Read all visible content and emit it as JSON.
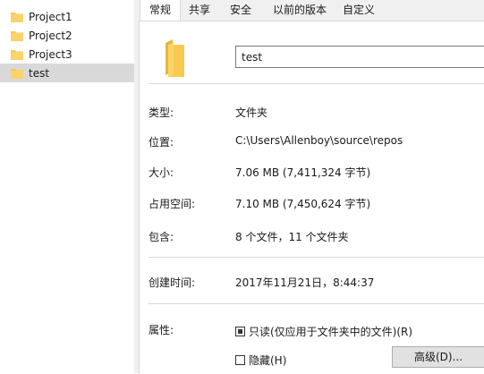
{
  "tree": {
    "items": [
      {
        "label": "Project1",
        "selected": false
      },
      {
        "label": "Project2",
        "selected": false
      },
      {
        "label": "Project3",
        "selected": false
      },
      {
        "label": "test",
        "selected": true
      }
    ]
  },
  "tabs": [
    {
      "label": "常规",
      "active": true
    },
    {
      "label": "共享",
      "active": false
    },
    {
      "label": "安全",
      "active": false
    },
    {
      "label": "以前的版本",
      "active": false
    },
    {
      "label": "自定义",
      "active": false
    }
  ],
  "general": {
    "name_value": "test",
    "type_label": "类型:",
    "type_value": "文件夹",
    "location_label": "位置:",
    "location_value": "C:\\Users\\Allenboy\\source\\repos",
    "size_label": "大小:",
    "size_value": "7.06 MB (7,411,324 字节)",
    "disk_size_label": "占用空间:",
    "disk_size_value": "7.10 MB (7,450,624 字节)",
    "contains_label": "包含:",
    "contains_value": "8 个文件，11 个文件夹",
    "created_label": "创建时间:",
    "created_value": "2017年11月21日，8:44:37",
    "attributes_label": "属性:",
    "readonly_label": "只读(仅应用于文件夹中的文件)(R)",
    "readonly_state": "indeterminate",
    "hidden_label": "隐藏(H)",
    "hidden_checked": false,
    "advanced_button": "高级(D)..."
  },
  "colors": {
    "folder": "#f7c950",
    "folder_dark": "#e8b53a",
    "selection": "#d9d9d9"
  }
}
